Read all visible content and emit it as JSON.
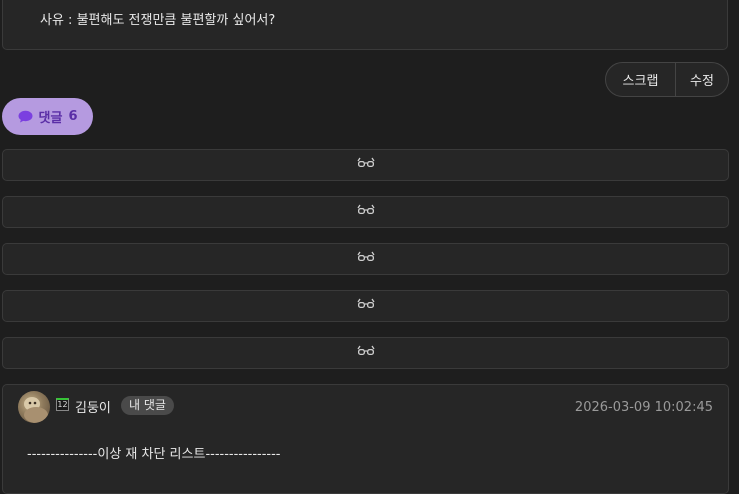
{
  "post": {
    "reason_text": "사유 : 불편해도 전쟁만큼 불편할까 싶어서?"
  },
  "actions": {
    "scrap_label": "스크랩",
    "edit_label": "수정"
  },
  "comments_toggle": {
    "icon": "speech-bubble-icon",
    "label": "댓글",
    "count": "6",
    "color": "#b59ae0"
  },
  "hidden_comments": [
    {
      "icon": "glasses-icon"
    },
    {
      "icon": "glasses-icon"
    },
    {
      "icon": "glasses-icon"
    },
    {
      "icon": "glasses-icon"
    },
    {
      "icon": "glasses-icon"
    }
  ],
  "comment": {
    "level": "12",
    "author": "김둥이",
    "my_badge": "내 댓글",
    "timestamp": "2026-03-09 10:02:45",
    "body": "---------------이상 재 차단 리스트----------------"
  }
}
